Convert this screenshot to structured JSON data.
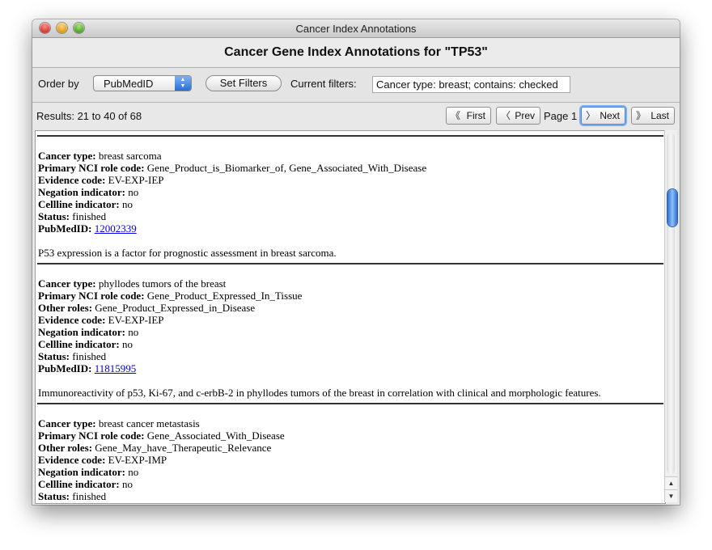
{
  "window": {
    "title": "Cancer Index Annotations"
  },
  "heading": "Cancer Gene Index Annotations for \"TP53\"",
  "toolbar": {
    "order_by_label": "Order by",
    "order_by_value": "PubMedID",
    "set_filters_label": "Set Filters",
    "current_filters_label": "Current filters:",
    "current_filters_value": "Cancer type: breast; contains: checked"
  },
  "nav": {
    "results_text": "Results: 21 to 40 of 68",
    "first_label": "First",
    "prev_label": "Prev",
    "page_label": "Page 1",
    "next_label": "Next",
    "last_label": "Last"
  },
  "labels": {
    "cancer_type": "Cancer type:",
    "primary_role": "Primary NCI role code:",
    "other_roles": "Other roles:",
    "evidence": "Evidence code:",
    "negation": "Negation indicator:",
    "cellline": "Cellline indicator:",
    "status": "Status:",
    "pubmed": "PubMedID:"
  },
  "entries": [
    {
      "cancer_type": "breast sarcoma",
      "primary_role": "Gene_Product_is_Biomarker_of, Gene_Associated_With_Disease",
      "evidence": "EV-EXP-IEP",
      "negation": "no",
      "cellline": "no",
      "status": "finished",
      "pubmed": "12002339",
      "sentence": "P53 expression is a factor for prognostic assessment in breast sarcoma."
    },
    {
      "cancer_type": "phyllodes tumors of the breast",
      "primary_role": "Gene_Product_Expressed_In_Tissue",
      "other_roles": "Gene_Product_Expressed_in_Disease",
      "evidence": "EV-EXP-IEP",
      "negation": "no",
      "cellline": "no",
      "status": "finished",
      "pubmed": "11815995",
      "sentence": "Immunoreactivity of p53, Ki-67, and c-erbB-2 in phyllodes tumors of the breast in correlation with clinical and morphologic features."
    },
    {
      "cancer_type": "breast cancer metastasis",
      "primary_role": "Gene_Associated_With_Disease",
      "other_roles": "Gene_May_have_Therapeutic_Relevance",
      "evidence": "EV-EXP-IMP",
      "negation": "no",
      "cellline": "no",
      "status": "finished"
    }
  ],
  "scroll": {
    "position_fraction": 0.17
  }
}
